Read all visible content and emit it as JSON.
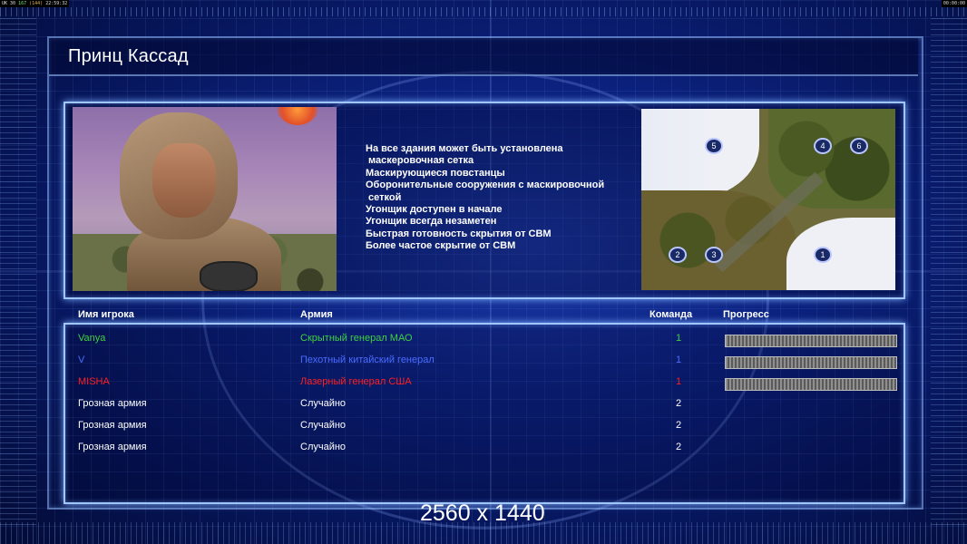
{
  "system": {
    "stat_left_a": "UK",
    "stat_left_b": "30",
    "stat_left_fps": "167",
    "stat_left_c": "(144)",
    "stat_left_time": "22:59:32",
    "stat_right_time": "00:00:00"
  },
  "header": {
    "general_name": "Принц Кассад"
  },
  "bonuses": [
    "На все здания может быть установлена",
    " маскеровочная сетка",
    "Маскирующиеся повстанцы",
    "Оборонительные сооружения с маскировочной",
    " сеткой",
    "Угонщик доступен в начале",
    "Угонщик всегда незаметен",
    "Быстрая готовность скрытия от СВМ",
    "Более частое скрытие от СВМ"
  ],
  "minimap": {
    "start_positions": [
      "5",
      "4",
      "6",
      "2",
      "3",
      "1"
    ]
  },
  "table": {
    "headers": {
      "name": "Имя игрока",
      "army": "Армия",
      "team": "Команда",
      "progress": "Прогресс"
    },
    "rows": [
      {
        "name": "Vanya",
        "army": "Скрытный генерал МАО",
        "team": "1",
        "color": "#3fd13f",
        "has_progress": true
      },
      {
        "name": "V",
        "army": "Пехотный китайский генерал",
        "team": "1",
        "color": "#4a6cff",
        "has_progress": true
      },
      {
        "name": "MISHA",
        "army": "Лазерный генерал США",
        "team": "1",
        "color": "#ff2020",
        "has_progress": true
      },
      {
        "name": "Грозная армия",
        "army": "Случайно",
        "team": "2",
        "color": "#ffffff",
        "has_progress": false
      },
      {
        "name": "Грозная армия",
        "army": "Случайно",
        "team": "2",
        "color": "#ffffff",
        "has_progress": false
      },
      {
        "name": "Грозная армия",
        "army": "Случайно",
        "team": "2",
        "color": "#ffffff",
        "has_progress": false
      }
    ]
  },
  "resolution_label": "2560 x 1440"
}
